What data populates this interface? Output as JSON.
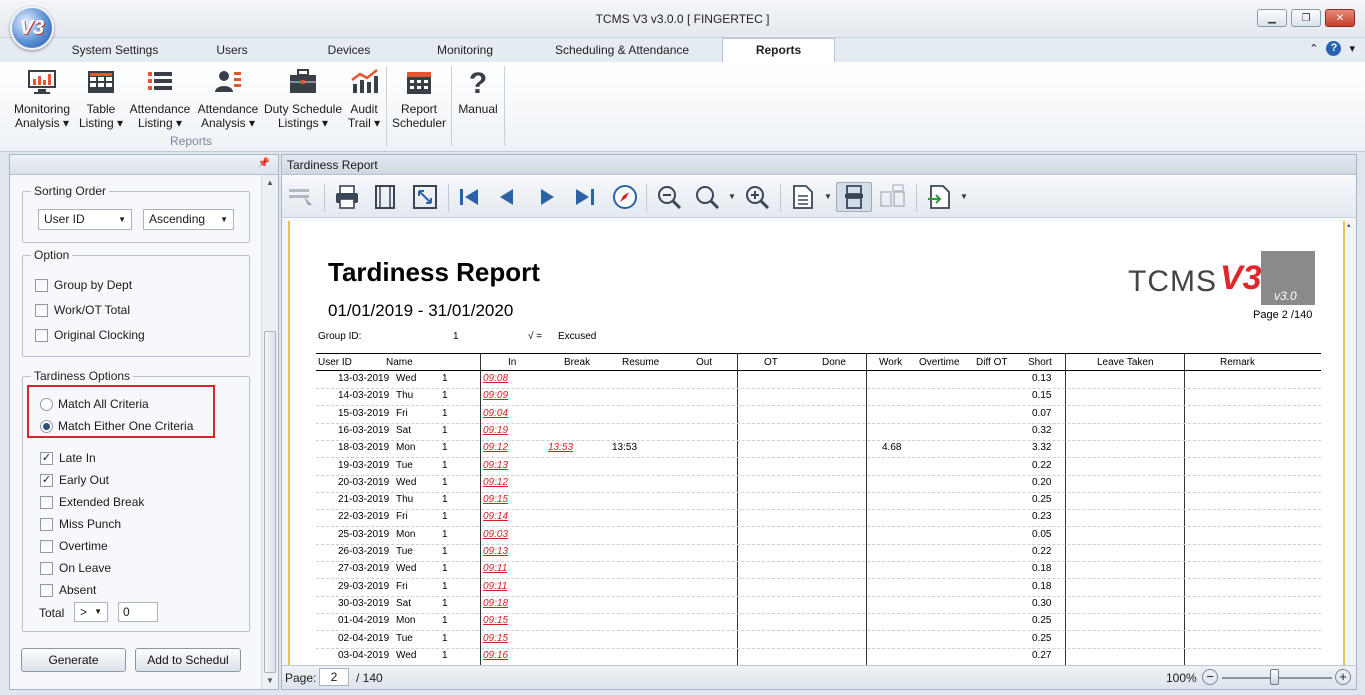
{
  "window": {
    "title": "TCMS V3 v3.0.0 [ FINGERTEC ]",
    "logo_text": "V3"
  },
  "tabs": [
    {
      "label": "System Settings"
    },
    {
      "label": "Users"
    },
    {
      "label": "Devices"
    },
    {
      "label": "Monitoring"
    },
    {
      "label": "Scheduling & Attendance"
    },
    {
      "label": "Reports",
      "active": true
    }
  ],
  "ribbon": {
    "buttons": [
      {
        "line1": "Monitoring",
        "line2": "Analysis",
        "dropdown": true,
        "icon": "monitor-chart-icon"
      },
      {
        "line1": "Table",
        "line2": "Listing",
        "dropdown": true,
        "icon": "table-icon"
      },
      {
        "line1": "Attendance",
        "line2": "Listing",
        "dropdown": true,
        "icon": "list-icon"
      },
      {
        "line1": "Attendance",
        "line2": "Analysis",
        "dropdown": true,
        "icon": "user-analysis-icon"
      },
      {
        "line1": "Duty Schedule",
        "line2": "Listings",
        "dropdown": true,
        "icon": "briefcase-icon"
      },
      {
        "line1": "Audit",
        "line2": "Trail",
        "dropdown": true,
        "icon": "audit-chart-icon"
      },
      {
        "line1": "Report",
        "line2": "Scheduler",
        "dropdown": false,
        "icon": "calendar-icon"
      },
      {
        "line1": "Manual",
        "line2": "",
        "dropdown": false,
        "icon": "question-icon"
      }
    ],
    "group_caption": "Reports"
  },
  "left_panel": {
    "sorting": {
      "legend": "Sorting Order",
      "field": "User ID",
      "order": "Ascending"
    },
    "option": {
      "legend": "Option",
      "items": [
        {
          "label": "Group by Dept",
          "checked": false
        },
        {
          "label": "Work/OT Total",
          "checked": false
        },
        {
          "label": "Original Clocking",
          "checked": false
        }
      ]
    },
    "tardiness": {
      "legend": "Tardiness Options",
      "radios": [
        {
          "label": "Match All Criteria",
          "selected": false
        },
        {
          "label": "Match Either One Criteria",
          "selected": true
        }
      ],
      "checks": [
        {
          "label": "Late In",
          "checked": true
        },
        {
          "label": "Early Out",
          "checked": true
        },
        {
          "label": "Extended Break",
          "checked": false
        },
        {
          "label": "Miss Punch",
          "checked": false
        },
        {
          "label": "Overtime",
          "checked": false
        },
        {
          "label": "On Leave",
          "checked": false
        },
        {
          "label": "Absent",
          "checked": false
        }
      ],
      "total_label": "Total",
      "total_op": ">",
      "total_value": "0"
    },
    "buttons": {
      "generate": "Generate",
      "add_schedule": "Add to Schedul"
    }
  },
  "report_panel": {
    "title": "Tardiness Report",
    "toolbar_icons": [
      "select-icon",
      "print-icon",
      "page-setup-icon",
      "fit-icon",
      "first-page-icon",
      "prev-page-icon",
      "next-page-icon",
      "last-page-icon",
      "navigate-icon",
      "zoom-out-icon",
      "zoom-icon",
      "zoom-in-icon",
      "multipage-icon",
      "single-page-icon",
      "two-pages-icon",
      "export-icon"
    ],
    "status": {
      "page_label": "Page:",
      "page_value": "2",
      "page_total": "/ 140",
      "zoom": "100%"
    }
  },
  "report": {
    "title": "Tardiness Report",
    "range": "01/01/2019 - 31/01/2020",
    "logo_main": "TCMS",
    "logo_v3": "V3",
    "logo_version": "v3.0",
    "page": "Page 2 /140",
    "group_label": "Group ID:",
    "group_value": "1",
    "legend_symbol": "√ =",
    "legend_text": "Excused",
    "columns": [
      "User ID",
      "Name",
      "In",
      "Break",
      "Resume",
      "Out",
      "OT",
      "Done",
      "Work",
      "Overtime",
      "Diff OT",
      "Short",
      "Leave Taken",
      "Remark"
    ],
    "rows": [
      {
        "date": "13-03-2019",
        "day": "Wed",
        "uid": "1",
        "in": "09:08",
        "brk": "",
        "resume": "",
        "work": "",
        "short": "0.13"
      },
      {
        "date": "14-03-2019",
        "day": "Thu",
        "uid": "1",
        "in": "09:09",
        "brk": "",
        "resume": "",
        "work": "",
        "short": "0.15"
      },
      {
        "date": "15-03-2019",
        "day": "Fri",
        "uid": "1",
        "in": "09:04",
        "brk": "",
        "resume": "",
        "work": "",
        "short": "0.07"
      },
      {
        "date": "16-03-2019",
        "day": "Sat",
        "uid": "1",
        "in": "09:19",
        "brk": "",
        "resume": "",
        "work": "",
        "short": "0.32"
      },
      {
        "date": "18-03-2019",
        "day": "Mon",
        "uid": "1",
        "in": "09:12",
        "brk": "13:53",
        "resume": "13:53",
        "work": "4.68",
        "short": "3.32"
      },
      {
        "date": "19-03-2019",
        "day": "Tue",
        "uid": "1",
        "in": "09:13",
        "brk": "",
        "resume": "",
        "work": "",
        "short": "0.22"
      },
      {
        "date": "20-03-2019",
        "day": "Wed",
        "uid": "1",
        "in": "09:12",
        "brk": "",
        "resume": "",
        "work": "",
        "short": "0.20"
      },
      {
        "date": "21-03-2019",
        "day": "Thu",
        "uid": "1",
        "in": "09:15",
        "brk": "",
        "resume": "",
        "work": "",
        "short": "0.25"
      },
      {
        "date": "22-03-2019",
        "day": "Fri",
        "uid": "1",
        "in": "09:14",
        "brk": "",
        "resume": "",
        "work": "",
        "short": "0.23"
      },
      {
        "date": "25-03-2019",
        "day": "Mon",
        "uid": "1",
        "in": "09:03",
        "brk": "",
        "resume": "",
        "work": "",
        "short": "0.05"
      },
      {
        "date": "26-03-2019",
        "day": "Tue",
        "uid": "1",
        "in": "09:13",
        "brk": "",
        "resume": "",
        "work": "",
        "short": "0.22"
      },
      {
        "date": "27-03-2019",
        "day": "Wed",
        "uid": "1",
        "in": "09:11",
        "brk": "",
        "resume": "",
        "work": "",
        "short": "0.18"
      },
      {
        "date": "29-03-2019",
        "day": "Fri",
        "uid": "1",
        "in": "09:11",
        "brk": "",
        "resume": "",
        "work": "",
        "short": "0.18"
      },
      {
        "date": "30-03-2019",
        "day": "Sat",
        "uid": "1",
        "in": "09:18",
        "brk": "",
        "resume": "",
        "work": "",
        "short": "0.30"
      },
      {
        "date": "01-04-2019",
        "day": "Mon",
        "uid": "1",
        "in": "09:15",
        "brk": "",
        "resume": "",
        "work": "",
        "short": "0.25"
      },
      {
        "date": "02-04-2019",
        "day": "Tue",
        "uid": "1",
        "in": "09:15",
        "brk": "",
        "resume": "",
        "work": "",
        "short": "0.25"
      },
      {
        "date": "03-04-2019",
        "day": "Wed",
        "uid": "1",
        "in": "09:16",
        "brk": "",
        "resume": "",
        "work": "",
        "short": "0.27"
      }
    ]
  },
  "colors": {
    "highlight": "#d6252d",
    "late": "#d42020",
    "accent": "#2a62b3"
  }
}
